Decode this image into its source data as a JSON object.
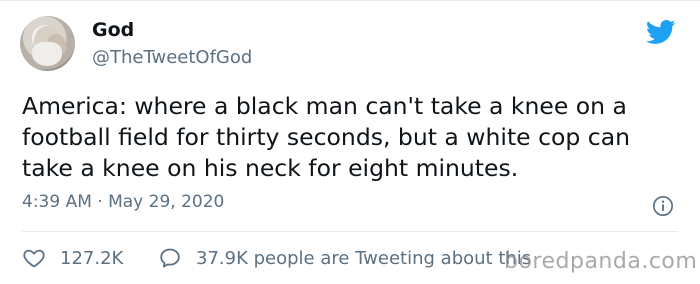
{
  "author": {
    "name": "God",
    "handle": "@TheTweetOfGod"
  },
  "tweet": {
    "text": "America: where a black man can't take a knee on a football field for thirty seconds, but a white cop can take a knee on his neck for eight minutes.",
    "timestamp": "4:39 AM · May 29, 2020"
  },
  "actions": {
    "likes": "127.2K",
    "tweeting_about": "37.9K people are Tweeting about this"
  },
  "watermark": "boredpanda.com",
  "icons": {
    "brand": "twitter-bird-icon",
    "info": "info-icon",
    "like": "heart-icon",
    "reply": "speech-bubble-icon"
  },
  "colors": {
    "twitter_blue": "#1da1f2",
    "text": "#0f1419",
    "muted": "#5b7083"
  }
}
